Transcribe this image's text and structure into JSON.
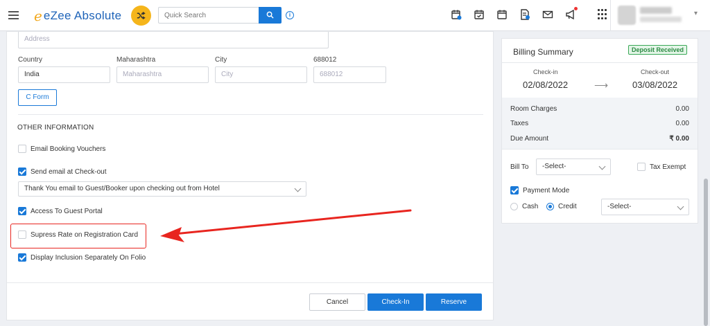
{
  "app": {
    "brand": "eZee Absolute"
  },
  "header": {
    "search_placeholder": "Quick Search",
    "icons": [
      "calendar-plus-icon",
      "calendar-check-icon",
      "calendar-icon",
      "invoice-icon",
      "mail-icon",
      "announcement-icon",
      "apps-grid-icon"
    ]
  },
  "address": {
    "address_placeholder": "Address",
    "country_label": "Country",
    "country_value": "India",
    "state_label": "Maharashtra",
    "state_placeholder": "Maharashtra",
    "city_label": "City",
    "city_placeholder": "City",
    "zip_label": "688012",
    "zip_placeholder": "688012",
    "cform_label": "C Form"
  },
  "other_info": {
    "title": "OTHER INFORMATION",
    "email_vouchers": {
      "label": "Email Booking Vouchers",
      "checked": false
    },
    "send_email": {
      "label": "Send email at Check-out",
      "checked": true
    },
    "email_template": "Thank You email to Guest/Booker upon checking out from Hotel",
    "guest_portal": {
      "label": "Access To Guest Portal",
      "checked": true
    },
    "suppress_rate": {
      "label": "Supress Rate on Registration Card",
      "checked": false
    },
    "display_inclusion": {
      "label": "Display Inclusion Separately On Folio",
      "checked": true
    }
  },
  "footer": {
    "cancel": "Cancel",
    "checkin": "Check-In",
    "reserve": "Reserve"
  },
  "billing": {
    "title": "Billing Summary",
    "status": "Deposit Received",
    "checkin_label": "Check-in",
    "checkin_date": "02/08/2022",
    "checkout_label": "Check-out",
    "checkout_date": "03/08/2022",
    "room_charges_label": "Room Charges",
    "room_charges": "0.00",
    "taxes_label": "Taxes",
    "taxes": "0.00",
    "due_label": "Due Amount",
    "due": "₹ 0.00",
    "bill_to_label": "Bill To",
    "bill_to_value": "-Select-",
    "tax_exempt_label": "Tax Exempt",
    "payment_mode_label": "Payment Mode",
    "cash_label": "Cash",
    "credit_label": "Credit",
    "payment_select": "-Select-"
  },
  "colors": {
    "primary": "#1979d8",
    "accent": "#f5b51b",
    "highlight": "#e8251f",
    "success": "#2b8a43"
  }
}
